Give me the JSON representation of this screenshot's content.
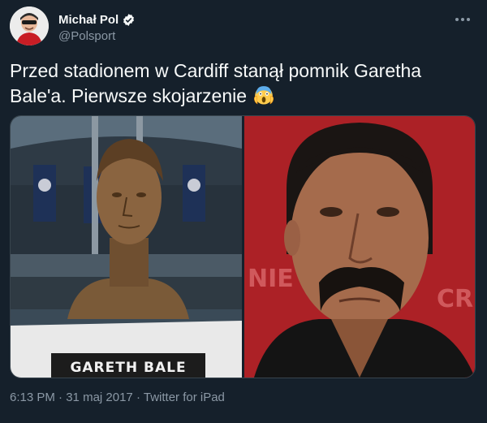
{
  "author": {
    "name": "Michał Pol",
    "handle": "@Polsport",
    "verified": true
  },
  "tweet": {
    "text_line1": "Przed stadionem w Cardiff stanął pomnik Garetha",
    "text_line2": "Bale'a. Pierwsze skojarzenie",
    "emoji": "face-screaming-in-fear-emoji"
  },
  "media": {
    "left_image": {
      "plate_text": "GARETH BALE"
    },
    "right_image": {
      "banner_fragment_1": "NIE",
      "banner_fragment_2": "CR"
    }
  },
  "meta": {
    "time": "6:13 PM",
    "date": "31 maj 2017",
    "source": "Twitter for iPad",
    "separator": "·"
  },
  "colors": {
    "background": "#15202b",
    "secondary_text": "#8b98a5",
    "verified_blue": "#1d9bf0"
  }
}
